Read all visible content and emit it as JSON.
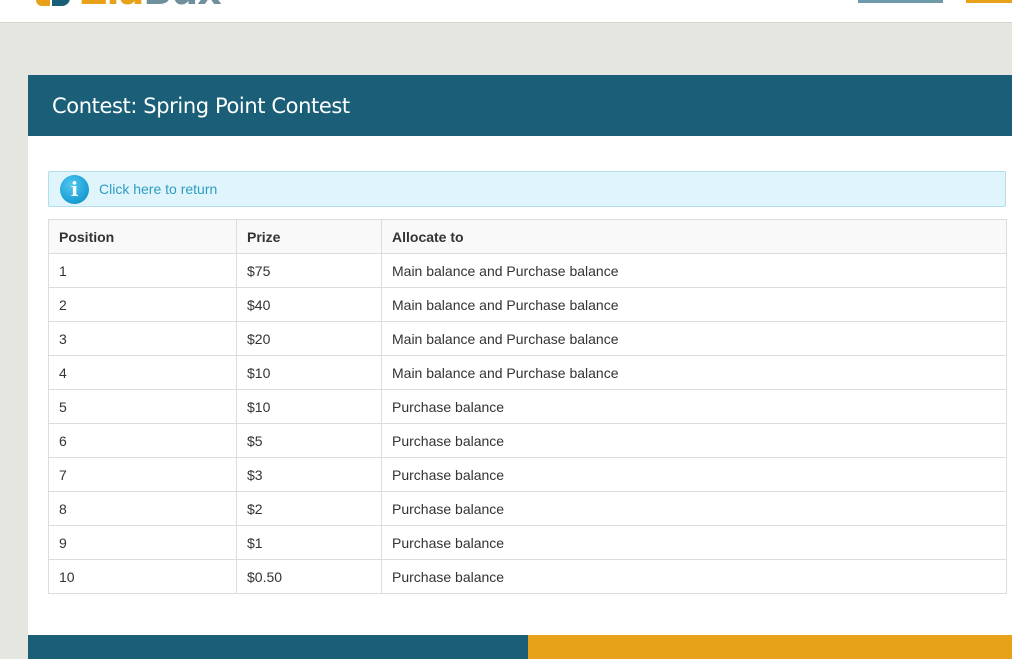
{
  "colors": {
    "brand_blue": "#1a5e78",
    "brand_gold": "#e8a21a",
    "alert_bg": "#e0f5fb",
    "link": "#2f9cc3",
    "page_bg": "#e6e6e1"
  },
  "logo": {
    "part1": "Zia",
    "part2": "Bux"
  },
  "panel": {
    "title": "Contest: Spring Point Contest"
  },
  "alert": {
    "icon": "info-icon",
    "link_text": "Click here to return"
  },
  "table": {
    "headers": [
      "Position",
      "Prize",
      "Allocate to"
    ],
    "rows": [
      [
        "1",
        "$75",
        "Main balance and Purchase balance"
      ],
      [
        "2",
        "$40",
        "Main balance and Purchase balance"
      ],
      [
        "3",
        "$20",
        "Main balance and Purchase balance"
      ],
      [
        "4",
        "$10",
        "Main balance and Purchase balance"
      ],
      [
        "5",
        "$10",
        "Purchase balance"
      ],
      [
        "6",
        "$5",
        "Purchase balance"
      ],
      [
        "7",
        "$3",
        "Purchase balance"
      ],
      [
        "8",
        "$2",
        "Purchase balance"
      ],
      [
        "9",
        "$1",
        "Purchase balance"
      ],
      [
        "10",
        "$0.50",
        "Purchase balance"
      ]
    ]
  }
}
